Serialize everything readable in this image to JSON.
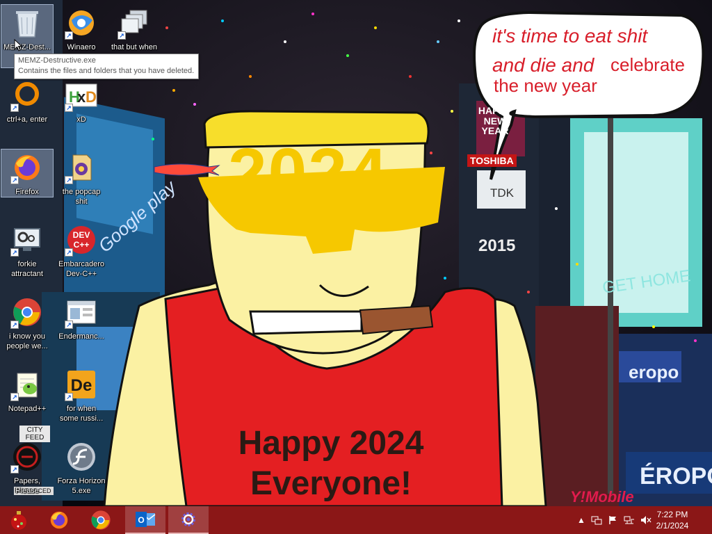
{
  "wallpaper": {
    "speech_line1": "it's time to eat shit",
    "speech_line2a": "and die and",
    "speech_line2b": "celebrate",
    "speech_line3": "the new year",
    "glasses_text": "2024",
    "shirt_line1": "Happy 2024",
    "shirt_line2": "Everyone!",
    "signs": {
      "hny": "HAPPY NEW YEAR",
      "toshiba": "TOSHIBA",
      "tdk": "TDK",
      "year_2015": "2015",
      "get_home": "GET HOME",
      "google_play": "Google play",
      "aeropostale": "eropo",
      "aero2": "ÉROPOS",
      "ymobile": "Y!Mobile",
      "city": "CITY FEED",
      "enforced": "ENFORCED"
    }
  },
  "desktop_icons": [
    {
      "label": "MEMZ-Dest...",
      "icon": "recycle-bin-icon",
      "selected": true
    },
    {
      "label": "Winaero",
      "icon": "winaero-icon"
    },
    {
      "label": "that but when",
      "icon": "stacked-windows-icon"
    },
    {
      "label": "ctrl+a, enter",
      "icon": "orange-ring-icon"
    },
    {
      "label": "xD",
      "icon": "xd-logo-icon"
    },
    {
      "label": "Firefox",
      "icon": "firefox-icon",
      "selected": true
    },
    {
      "label": "the popcap shit",
      "icon": "popcap-icon"
    },
    {
      "label": "forkie attractant",
      "icon": "monitor-gear-icon"
    },
    {
      "label": "Embarcadero Dev-C++",
      "icon": "devcpp-icon"
    },
    {
      "label": "i know you people we...",
      "icon": "chrome-icon"
    },
    {
      "label": "Endermanc...",
      "icon": "window-app-icon"
    },
    {
      "label": "Notepad++",
      "icon": "notepadpp-icon"
    },
    {
      "label": "for when some russi...",
      "icon": "de-icon"
    },
    {
      "label": "Papers, Please",
      "icon": "papers-please-icon"
    },
    {
      "label": "Forza Horizon 5.exe",
      "icon": "flash-icon"
    }
  ],
  "tooltip": {
    "title": "MEMZ-Destructive.exe",
    "desc": "Contains the files and folders that you have deleted."
  },
  "taskbar": {
    "start_icon": "christmas-ornament-icon",
    "pinned": [
      "firefox-icon",
      "chrome-icon",
      "outlook-icon",
      "settings-icon"
    ],
    "clock_time": "7:22 PM",
    "clock_date": "2/1/2024",
    "tray": [
      "chevron-up-icon",
      "network-icon",
      "flag-icon",
      "ethernet-icon",
      "volume-muted-icon"
    ]
  }
}
